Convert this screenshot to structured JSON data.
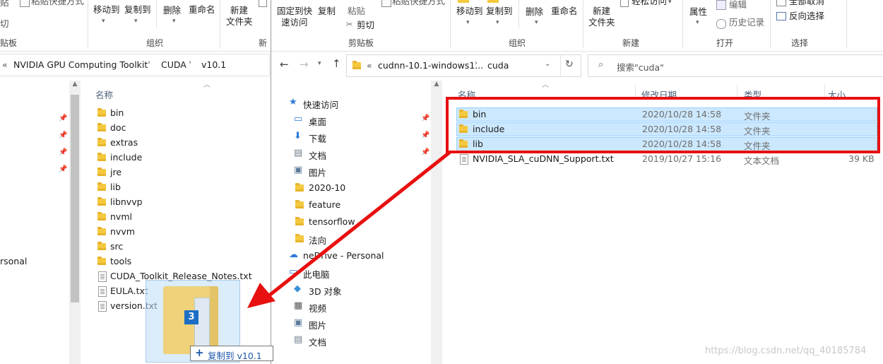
{
  "left_window": {
    "ribbon": {
      "cut_partial": "贴",
      "cut2_partial": "切",
      "paste_shortcut": "粘贴快捷方式",
      "move_to": "移动到",
      "copy_to": "复制到",
      "delete": "删除",
      "rename": "重命名",
      "new_folder_line1": "新建",
      "new_folder_line2": "文件夹",
      "new_partial": "新",
      "group_clipboard_partial": "贴板",
      "group_organize": "组织"
    },
    "breadcrumb": {
      "chevrons": "«",
      "items": [
        "NVIDIA GPU Computing Toolkit",
        "CUDA",
        "v10.1"
      ]
    },
    "sidebar_partial": "rsonal",
    "column_name": "名称",
    "files": [
      {
        "name": "bin",
        "type": "folder"
      },
      {
        "name": "doc",
        "type": "folder"
      },
      {
        "name": "extras",
        "type": "folder"
      },
      {
        "name": "include",
        "type": "folder"
      },
      {
        "name": "jre",
        "type": "folder"
      },
      {
        "name": "lib",
        "type": "folder"
      },
      {
        "name": "libnvvp",
        "type": "folder"
      },
      {
        "name": "nvml",
        "type": "folder"
      },
      {
        "name": "nvvm",
        "type": "folder"
      },
      {
        "name": "src",
        "type": "folder"
      },
      {
        "name": "tools",
        "type": "folder"
      },
      {
        "name": "CUDA_Toolkit_Release_Notes.txt",
        "type": "file"
      },
      {
        "name": "EULA.txt",
        "type": "file"
      },
      {
        "name": "version.txt",
        "type": "file"
      }
    ]
  },
  "drag": {
    "count": "3",
    "tooltip": "复制到 v10.1",
    "plus": "+"
  },
  "right_window": {
    "ribbon": {
      "pin_quick_line1": "固定到快",
      "pin_quick_line2": "速访问",
      "copy": "复制",
      "paste": "粘贴",
      "cut": "剪切",
      "paste_shortcut": "粘贴快捷方式",
      "move_to": "移动到",
      "copy_to": "复制到",
      "delete": "删除",
      "rename": "重命名",
      "new_folder_line1": "新建",
      "new_folder_line2": "文件夹",
      "easy_access": "轻松访问",
      "properties": "属性",
      "edit": "编辑",
      "history": "历史记录",
      "select_none": "全部取消",
      "invert_selection": "反向选择",
      "group_clipboard": "剪贴板",
      "group_organize": "组织",
      "group_new": "新建",
      "group_open": "打开",
      "group_select": "选择"
    },
    "address": {
      "chevrons": "«",
      "items": [
        "cudnn-10.1-windows1...",
        "cuda"
      ],
      "search_placeholder": "搜索\"cuda\""
    },
    "nav": [
      {
        "label": "快速访问",
        "icon": "star-icon",
        "level": 0
      },
      {
        "label": "桌面",
        "icon": "desktop-icon",
        "level": 1,
        "pinned": true
      },
      {
        "label": "下载",
        "icon": "download-icon",
        "level": 1,
        "pinned": true
      },
      {
        "label": "文档",
        "icon": "document-icon",
        "level": 1,
        "pinned": true
      },
      {
        "label": "图片",
        "icon": "picture-icon",
        "level": 1,
        "pinned": false
      },
      {
        "label": "2020-10",
        "icon": "folder-icon",
        "level": 1
      },
      {
        "label": "feature",
        "icon": "folder-icon",
        "level": 1
      },
      {
        "label": "tensorflow",
        "icon": "folder-icon",
        "level": 1
      },
      {
        "label": "法向",
        "icon": "folder-icon",
        "level": 1
      },
      {
        "label": "neDrive - Personal",
        "icon": "cloud-icon",
        "level": 0
      },
      {
        "label": "此电脑",
        "icon": "pc-icon",
        "level": 0
      },
      {
        "label": "3D 对象",
        "icon": "cube-icon",
        "level": 1
      },
      {
        "label": "视频",
        "icon": "video-icon",
        "level": 1
      },
      {
        "label": "图片",
        "icon": "picture-icon",
        "level": 1
      },
      {
        "label": "文档",
        "icon": "document-icon",
        "level": 1
      }
    ],
    "columns": {
      "name": "名称",
      "modified": "修改日期",
      "type": "类型",
      "size": "大小"
    },
    "files": [
      {
        "name": "bin",
        "modified": "2020/10/28 14:58",
        "type": "文件夹",
        "size": "",
        "selected": true,
        "kind": "folder"
      },
      {
        "name": "include",
        "modified": "2020/10/28 14:58",
        "type": "文件夹",
        "size": "",
        "selected": true,
        "kind": "folder"
      },
      {
        "name": "lib",
        "modified": "2020/10/28 14:58",
        "type": "文件夹",
        "size": "",
        "selected": true,
        "kind": "folder"
      },
      {
        "name": "NVIDIA_SLA_cuDNN_Support.txt",
        "modified": "2019/10/27 15:16",
        "type": "文本文档",
        "size": "39 KB",
        "selected": false,
        "kind": "file"
      }
    ]
  },
  "watermark": "https://blog.csdn.net/qq_40185784",
  "colors": {
    "annotation_red": "#e81010",
    "selection_bg": "#cce8ff",
    "selection_border": "#99d1ff",
    "folder_yellow": "#f5c93f"
  }
}
